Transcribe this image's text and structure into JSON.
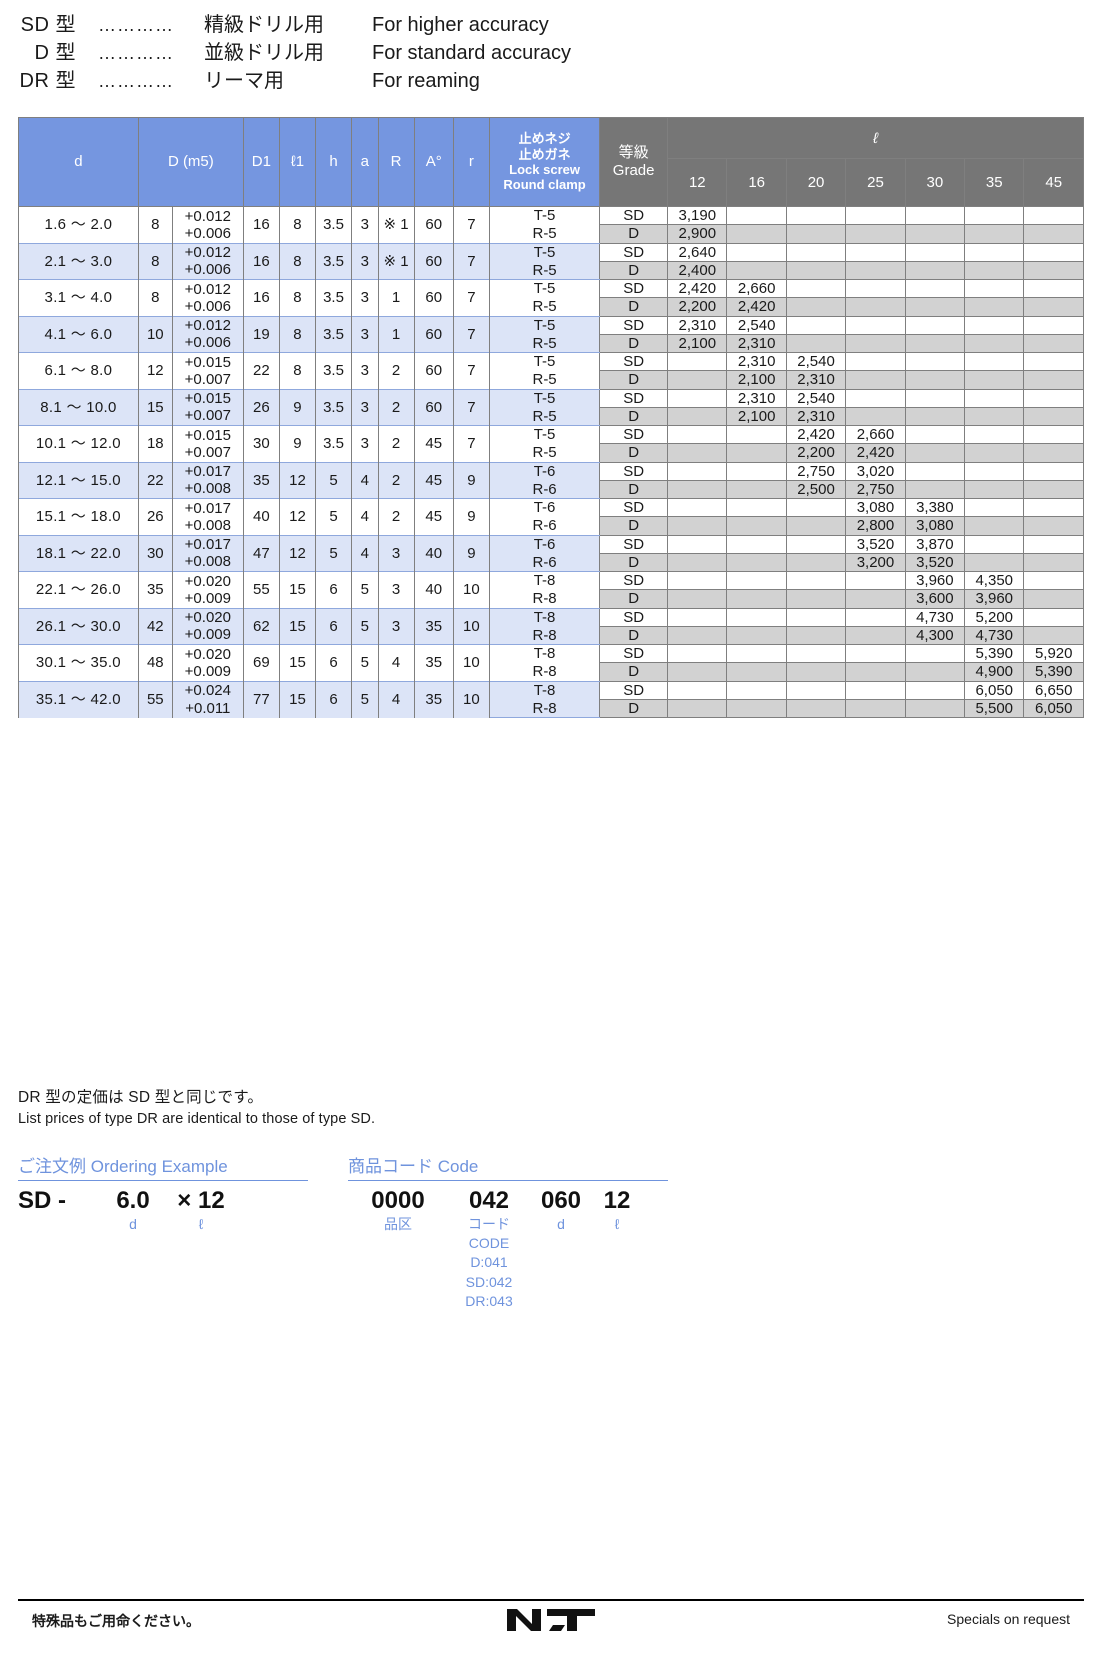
{
  "legend": {
    "rows": [
      {
        "type": "SD 型",
        "dots": "…………",
        "jp": "精級ドリル用",
        "en": "For higher accuracy"
      },
      {
        "type": "D 型",
        "dots": "…………",
        "jp": "並級ドリル用",
        "en": "For standard accuracy"
      },
      {
        "type": "DR 型",
        "dots": "…………",
        "jp": "リーマ用",
        "en": "For reaming"
      }
    ]
  },
  "table": {
    "headers": {
      "d": "d",
      "D": "D (m5)",
      "D1": "D1",
      "l1": "ℓ1",
      "h": "h",
      "a": "a",
      "R": "R",
      "A": "A°",
      "r": "r",
      "lock_jp1": "止めネジ",
      "lock_jp2": "止めガネ",
      "lock_en1": "Lock screw",
      "lock_en2": "Round clamp",
      "grade_jp": "等級",
      "grade_en": "Grade",
      "ell": "ℓ",
      "lengths": [
        "12",
        "16",
        "20",
        "25",
        "30",
        "35",
        "45"
      ]
    },
    "rows": [
      {
        "d": "1.6 〜 2.0",
        "D": "8",
        "tol_hi": "+0.012",
        "tol_lo": "+0.006",
        "D1": "16",
        "l1": "8",
        "h": "3.5",
        "a": "3",
        "R": "※ 1",
        "A": "60",
        "r": "7",
        "lock_sd": "T-5",
        "lock_d": "R-5",
        "grade_sd": "SD",
        "grade_d": "D",
        "prices_sd": [
          "3,190",
          "",
          "",
          "",
          "",
          "",
          ""
        ],
        "prices_d": [
          "2,900",
          "",
          "",
          "",
          "",
          "",
          ""
        ]
      },
      {
        "d": "2.1 〜 3.0",
        "D": "8",
        "tol_hi": "+0.012",
        "tol_lo": "+0.006",
        "D1": "16",
        "l1": "8",
        "h": "3.5",
        "a": "3",
        "R": "※ 1",
        "A": "60",
        "r": "7",
        "lock_sd": "T-5",
        "lock_d": "R-5",
        "grade_sd": "SD",
        "grade_d": "D",
        "prices_sd": [
          "2,640",
          "",
          "",
          "",
          "",
          "",
          ""
        ],
        "prices_d": [
          "2,400",
          "",
          "",
          "",
          "",
          "",
          ""
        ]
      },
      {
        "d": "3.1 〜 4.0",
        "D": "8",
        "tol_hi": "+0.012",
        "tol_lo": "+0.006",
        "D1": "16",
        "l1": "8",
        "h": "3.5",
        "a": "3",
        "R": "1",
        "A": "60",
        "r": "7",
        "lock_sd": "T-5",
        "lock_d": "R-5",
        "grade_sd": "SD",
        "grade_d": "D",
        "prices_sd": [
          "2,420",
          "2,660",
          "",
          "",
          "",
          "",
          ""
        ],
        "prices_d": [
          "2,200",
          "2,420",
          "",
          "",
          "",
          "",
          ""
        ]
      },
      {
        "d": "4.1 〜 6.0",
        "D": "10",
        "tol_hi": "+0.012",
        "tol_lo": "+0.006",
        "D1": "19",
        "l1": "8",
        "h": "3.5",
        "a": "3",
        "R": "1",
        "A": "60",
        "r": "7",
        "lock_sd": "T-5",
        "lock_d": "R-5",
        "grade_sd": "SD",
        "grade_d": "D",
        "prices_sd": [
          "2,310",
          "2,540",
          "",
          "",
          "",
          "",
          ""
        ],
        "prices_d": [
          "2,100",
          "2,310",
          "",
          "",
          "",
          "",
          ""
        ]
      },
      {
        "d": "6.1 〜 8.0",
        "D": "12",
        "tol_hi": "+0.015",
        "tol_lo": "+0.007",
        "D1": "22",
        "l1": "8",
        "h": "3.5",
        "a": "3",
        "R": "2",
        "A": "60",
        "r": "7",
        "lock_sd": "T-5",
        "lock_d": "R-5",
        "grade_sd": "SD",
        "grade_d": "D",
        "prices_sd": [
          "",
          "2,310",
          "2,540",
          "",
          "",
          "",
          ""
        ],
        "prices_d": [
          "",
          "2,100",
          "2,310",
          "",
          "",
          "",
          ""
        ]
      },
      {
        "d": "8.1 〜 10.0",
        "D": "15",
        "tol_hi": "+0.015",
        "tol_lo": "+0.007",
        "D1": "26",
        "l1": "9",
        "h": "3.5",
        "a": "3",
        "R": "2",
        "A": "60",
        "r": "7",
        "lock_sd": "T-5",
        "lock_d": "R-5",
        "grade_sd": "SD",
        "grade_d": "D",
        "prices_sd": [
          "",
          "2,310",
          "2,540",
          "",
          "",
          "",
          ""
        ],
        "prices_d": [
          "",
          "2,100",
          "2,310",
          "",
          "",
          "",
          ""
        ]
      },
      {
        "d": "10.1 〜 12.0",
        "D": "18",
        "tol_hi": "+0.015",
        "tol_lo": "+0.007",
        "D1": "30",
        "l1": "9",
        "h": "3.5",
        "a": "3",
        "R": "2",
        "A": "45",
        "r": "7",
        "lock_sd": "T-5",
        "lock_d": "R-5",
        "grade_sd": "SD",
        "grade_d": "D",
        "prices_sd": [
          "",
          "",
          "2,420",
          "2,660",
          "",
          "",
          ""
        ],
        "prices_d": [
          "",
          "",
          "2,200",
          "2,420",
          "",
          "",
          ""
        ]
      },
      {
        "d": "12.1 〜 15.0",
        "D": "22",
        "tol_hi": "+0.017",
        "tol_lo": "+0.008",
        "D1": "35",
        "l1": "12",
        "h": "5",
        "a": "4",
        "R": "2",
        "A": "45",
        "r": "9",
        "lock_sd": "T-6",
        "lock_d": "R-6",
        "grade_sd": "SD",
        "grade_d": "D",
        "prices_sd": [
          "",
          "",
          "2,750",
          "3,020",
          "",
          "",
          ""
        ],
        "prices_d": [
          "",
          "",
          "2,500",
          "2,750",
          "",
          "",
          ""
        ]
      },
      {
        "d": "15.1 〜 18.0",
        "D": "26",
        "tol_hi": "+0.017",
        "tol_lo": "+0.008",
        "D1": "40",
        "l1": "12",
        "h": "5",
        "a": "4",
        "R": "2",
        "A": "45",
        "r": "9",
        "lock_sd": "T-6",
        "lock_d": "R-6",
        "grade_sd": "SD",
        "grade_d": "D",
        "prices_sd": [
          "",
          "",
          "",
          "3,080",
          "3,380",
          "",
          ""
        ],
        "prices_d": [
          "",
          "",
          "",
          "2,800",
          "3,080",
          "",
          ""
        ]
      },
      {
        "d": "18.1 〜 22.0",
        "D": "30",
        "tol_hi": "+0.017",
        "tol_lo": "+0.008",
        "D1": "47",
        "l1": "12",
        "h": "5",
        "a": "4",
        "R": "3",
        "A": "40",
        "r": "9",
        "lock_sd": "T-6",
        "lock_d": "R-6",
        "grade_sd": "SD",
        "grade_d": "D",
        "prices_sd": [
          "",
          "",
          "",
          "3,520",
          "3,870",
          "",
          ""
        ],
        "prices_d": [
          "",
          "",
          "",
          "3,200",
          "3,520",
          "",
          ""
        ]
      },
      {
        "d": "22.1 〜 26.0",
        "D": "35",
        "tol_hi": "+0.020",
        "tol_lo": "+0.009",
        "D1": "55",
        "l1": "15",
        "h": "6",
        "a": "5",
        "R": "3",
        "A": "40",
        "r": "10",
        "lock_sd": "T-8",
        "lock_d": "R-8",
        "grade_sd": "SD",
        "grade_d": "D",
        "prices_sd": [
          "",
          "",
          "",
          "",
          "3,960",
          "4,350",
          ""
        ],
        "prices_d": [
          "",
          "",
          "",
          "",
          "3,600",
          "3,960",
          ""
        ]
      },
      {
        "d": "26.1 〜 30.0",
        "D": "42",
        "tol_hi": "+0.020",
        "tol_lo": "+0.009",
        "D1": "62",
        "l1": "15",
        "h": "6",
        "a": "5",
        "R": "3",
        "A": "35",
        "r": "10",
        "lock_sd": "T-8",
        "lock_d": "R-8",
        "grade_sd": "SD",
        "grade_d": "D",
        "prices_sd": [
          "",
          "",
          "",
          "",
          "4,730",
          "5,200",
          ""
        ],
        "prices_d": [
          "",
          "",
          "",
          "",
          "4,300",
          "4,730",
          ""
        ]
      },
      {
        "d": "30.1 〜 35.0",
        "D": "48",
        "tol_hi": "+0.020",
        "tol_lo": "+0.009",
        "D1": "69",
        "l1": "15",
        "h": "6",
        "a": "5",
        "R": "4",
        "A": "35",
        "r": "10",
        "lock_sd": "T-8",
        "lock_d": "R-8",
        "grade_sd": "SD",
        "grade_d": "D",
        "prices_sd": [
          "",
          "",
          "",
          "",
          "",
          "5,390",
          "5,920"
        ],
        "prices_d": [
          "",
          "",
          "",
          "",
          "",
          "4,900",
          "5,390"
        ]
      },
      {
        "d": "35.1 〜 42.0",
        "D": "55",
        "tol_hi": "+0.024",
        "tol_lo": "+0.011",
        "D1": "77",
        "l1": "15",
        "h": "6",
        "a": "5",
        "R": "4",
        "A": "35",
        "r": "10",
        "lock_sd": "T-8",
        "lock_d": "R-8",
        "grade_sd": "SD",
        "grade_d": "D",
        "prices_sd": [
          "",
          "",
          "",
          "",
          "",
          "6,050",
          "6,650"
        ],
        "prices_d": [
          "",
          "",
          "",
          "",
          "",
          "5,500",
          "6,050"
        ]
      }
    ]
  },
  "notes": {
    "jp": "DR 型の定価は SD 型と同じです。",
    "en": "List prices of type DR are identical to those of type SD."
  },
  "ordering": {
    "left": {
      "title": "ご注文例 Ordering Example",
      "segments": [
        {
          "code": "SD -",
          "label": ""
        },
        {
          "code": "",
          "label": ""
        },
        {
          "code": "6.0",
          "label": "d"
        },
        {
          "code": "× 12",
          "label": "ℓ"
        }
      ]
    },
    "right": {
      "title": "商品コード Code",
      "segments": [
        {
          "code": "0000",
          "label": "品区"
        },
        {
          "code": "042",
          "label": "コード"
        },
        {
          "code": "060",
          "label": "d"
        },
        {
          "code": "12",
          "label": "ℓ"
        }
      ],
      "code_list": [
        "CODE",
        "D:041",
        "SD:042",
        "DR:043"
      ]
    }
  },
  "footer": {
    "left": "特殊品もご用命ください。",
    "right": "Specials on request",
    "logo": "NT"
  },
  "colors": {
    "header_blue": "#7596e0",
    "header_grey": "#767676",
    "band_blue": "#dce4f7",
    "price_grey": "#d2d2d2",
    "accent_blue": "#6f93dd"
  }
}
